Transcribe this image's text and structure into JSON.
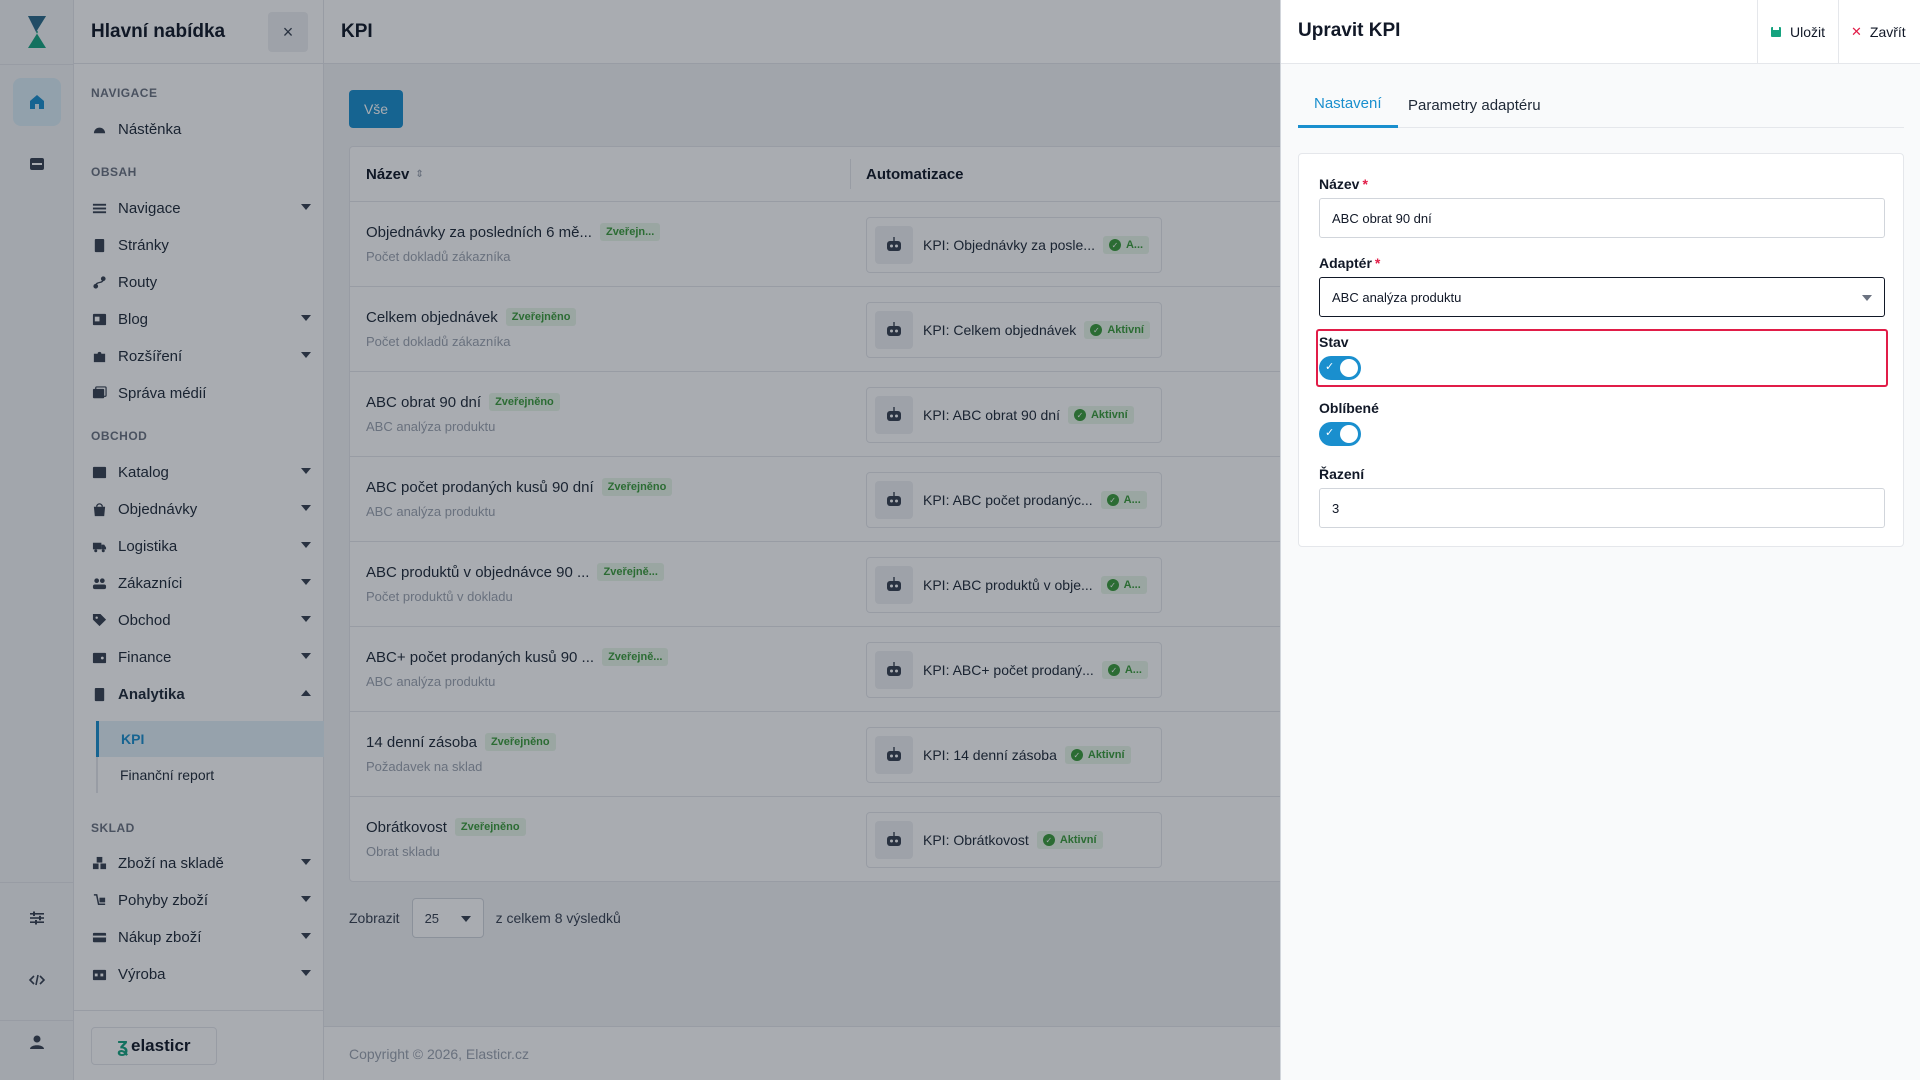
{
  "rail": {
    "items": [
      {
        "icon": "home-icon"
      },
      {
        "icon": "inbox-icon"
      },
      {
        "icon": "sliders-icon"
      },
      {
        "icon": "code-icon"
      },
      {
        "icon": "user-icon"
      }
    ]
  },
  "sidebar": {
    "title": "Hlavní nabídka",
    "close_label": "×",
    "sections": {
      "navigace": "NAVIGACE",
      "obsah": "OBSAH",
      "obchod": "OBCHOD",
      "sklad": "SKLAD"
    },
    "items": {
      "nastenka": "Nástěnka",
      "navigace": "Navigace",
      "stranky": "Stránky",
      "routy": "Routy",
      "blog": "Blog",
      "rozsireni": "Rozšíření",
      "sprava_medii": "Správa médií",
      "katalog": "Katalog",
      "objednavky": "Objednávky",
      "logistika": "Logistika",
      "zakaznici": "Zákazníci",
      "obchod": "Obchod",
      "finance": "Finance",
      "analytika": "Analytika",
      "kpi": "KPI",
      "financni_report": "Finanční report",
      "zbozi_na_sklade": "Zboží na skladě",
      "pohyby_zbozi": "Pohyby zboží",
      "nakup_zbozi": "Nákup zboží",
      "vyroba": "Výroba"
    },
    "brand": "elasticr"
  },
  "main": {
    "title": "KPI",
    "filter_all": "Vše",
    "columns": {
      "name": "Název",
      "sort_icon": "⇕",
      "automation": "Automatizace"
    },
    "rows": [
      {
        "name": "Objednávky za posledních 6 mě...",
        "status": "Zveřejn...",
        "sub": "Počet dokladů zákazníka",
        "automation": "KPI: Objednávky za posle...",
        "auto_status": "A..."
      },
      {
        "name": "Celkem objednávek",
        "status": "Zveřejněno",
        "sub": "Počet dokladů zákazníka",
        "automation": "KPI: Celkem objednávek",
        "auto_status": "Aktivní"
      },
      {
        "name": "ABC obrat 90 dní",
        "status": "Zveřejněno",
        "sub": "ABC analýza produktu",
        "automation": "KPI: ABC obrat 90 dní",
        "auto_status": "Aktivní"
      },
      {
        "name": "ABC počet prodaných kusů 90 dní",
        "status": "Zveřejněno",
        "sub": "ABC analýza produktu",
        "automation": "KPI: ABC počet prodanýc...",
        "auto_status": "A..."
      },
      {
        "name": "ABC produktů v objednávce 90 ...",
        "status": "Zveřejně...",
        "sub": "Počet produktů v dokladu",
        "automation": "KPI: ABC produktů v obje...",
        "auto_status": "A..."
      },
      {
        "name": "ABC+ počet prodaných kusů 90 ...",
        "status": "Zveřejně...",
        "sub": "ABC analýza produktu",
        "automation": "KPI: ABC+ počet prodaný...",
        "auto_status": "A..."
      },
      {
        "name": "14 denní zásoba",
        "status": "Zveřejněno",
        "sub": "Požadavek na sklad",
        "automation": "KPI: 14 denní zásoba",
        "auto_status": "Aktivní"
      },
      {
        "name": "Obrátkovost",
        "status": "Zveřejněno",
        "sub": "Obrat skladu",
        "automation": "KPI: Obrátkovost",
        "auto_status": "Aktivní"
      }
    ],
    "pager": {
      "show_label": "Zobrazit",
      "page_size": "25",
      "total_label": "z celkem 8 výsledků"
    },
    "copyright": "Copyright © 2026, Elasticr.cz"
  },
  "drawer": {
    "title": "Upravit KPI",
    "save_label": "Uložit",
    "close_label": "Zavřít",
    "tabs": [
      "Nastavení",
      "Parametry adaptéru"
    ],
    "form": {
      "name_label": "Název",
      "name_value": "ABC obrat 90 dní",
      "adapter_label": "Adaptér",
      "adapter_value": "ABC analýza produktu",
      "status_label": "Stav",
      "status_on": true,
      "favorite_label": "Oblíbené",
      "favorite_on": true,
      "order_label": "Řazení",
      "order_value": "3",
      "required_mark": "*"
    }
  },
  "colors": {
    "accent": "#1a8fce",
    "brand": "#15a37f",
    "published_bg": "#e8f6e8",
    "published_text": "#3a9b3a",
    "highlight": "#e11d48"
  }
}
